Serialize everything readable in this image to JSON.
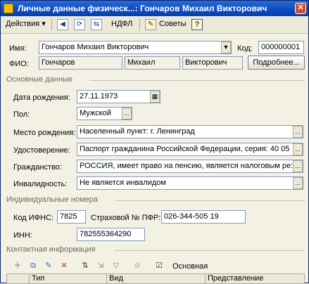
{
  "window": {
    "title": "Личные данные физическ...: Гончаров Михаил Викторович",
    "close_label": "✕"
  },
  "toolbar": {
    "actions_label": "Действия ▾",
    "ndfl_label": "НДФЛ",
    "advice_label": "Советы",
    "help_label": "?"
  },
  "form": {
    "name_label": "Имя:",
    "name_value": "Гончаров Михаил Викторович",
    "code_label": "Код:",
    "code_value": "000000001",
    "fio_label": "ФИО:",
    "fio_last": "Гончаров",
    "fio_first": "Михаил",
    "fio_middle": "Викторович",
    "details_button": "Подробнее..."
  },
  "main_section": {
    "title": "Основные данные",
    "birth_date_label": "Дата рождения:",
    "birth_date_value": "27.11.1973",
    "gender_label": "Пол:",
    "gender_value": "Мужской",
    "birthplace_label": "Место рождения:",
    "birthplace_value": "Населенный пункт: г. Ленинград",
    "id_doc_label": "Удостоверение:",
    "id_doc_value": "Паспорт гражданина Российской Федерации, серия: 40 05",
    "citizenship_label": "Гражданство:",
    "citizenship_value": "РОССИЯ, имеет право на пенсию, является налоговым ре:",
    "disability_label": "Инвалидность:",
    "disability_value": "Не является инвалидом"
  },
  "ids_section": {
    "title": "Индивидуальные номера",
    "ifns_label": "Код ИФНС:",
    "ifns_value": "7825",
    "pfr_label": "Страховой № ПФР:",
    "pfr_value": "026-344-505 19",
    "inn_label": "ИНН:",
    "inn_value": "782555364290"
  },
  "contact_section": {
    "title": "Контактная информация",
    "main_label": "Основная",
    "columns": [
      "Тип",
      "Вид",
      "Представление"
    ]
  }
}
